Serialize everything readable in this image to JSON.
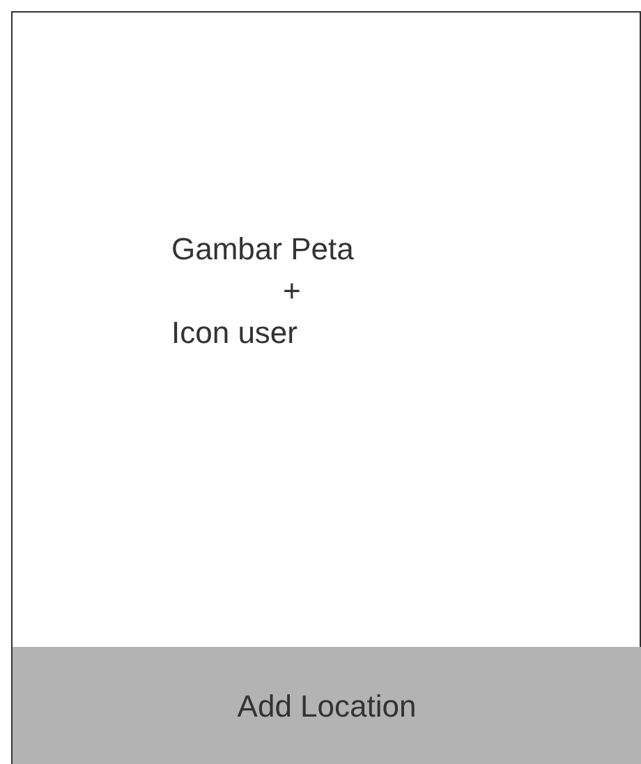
{
  "map_placeholder": {
    "lines": [
      "Gambar Peta",
      "+",
      "Icon user"
    ]
  },
  "add_button": {
    "label": "Add Location"
  }
}
